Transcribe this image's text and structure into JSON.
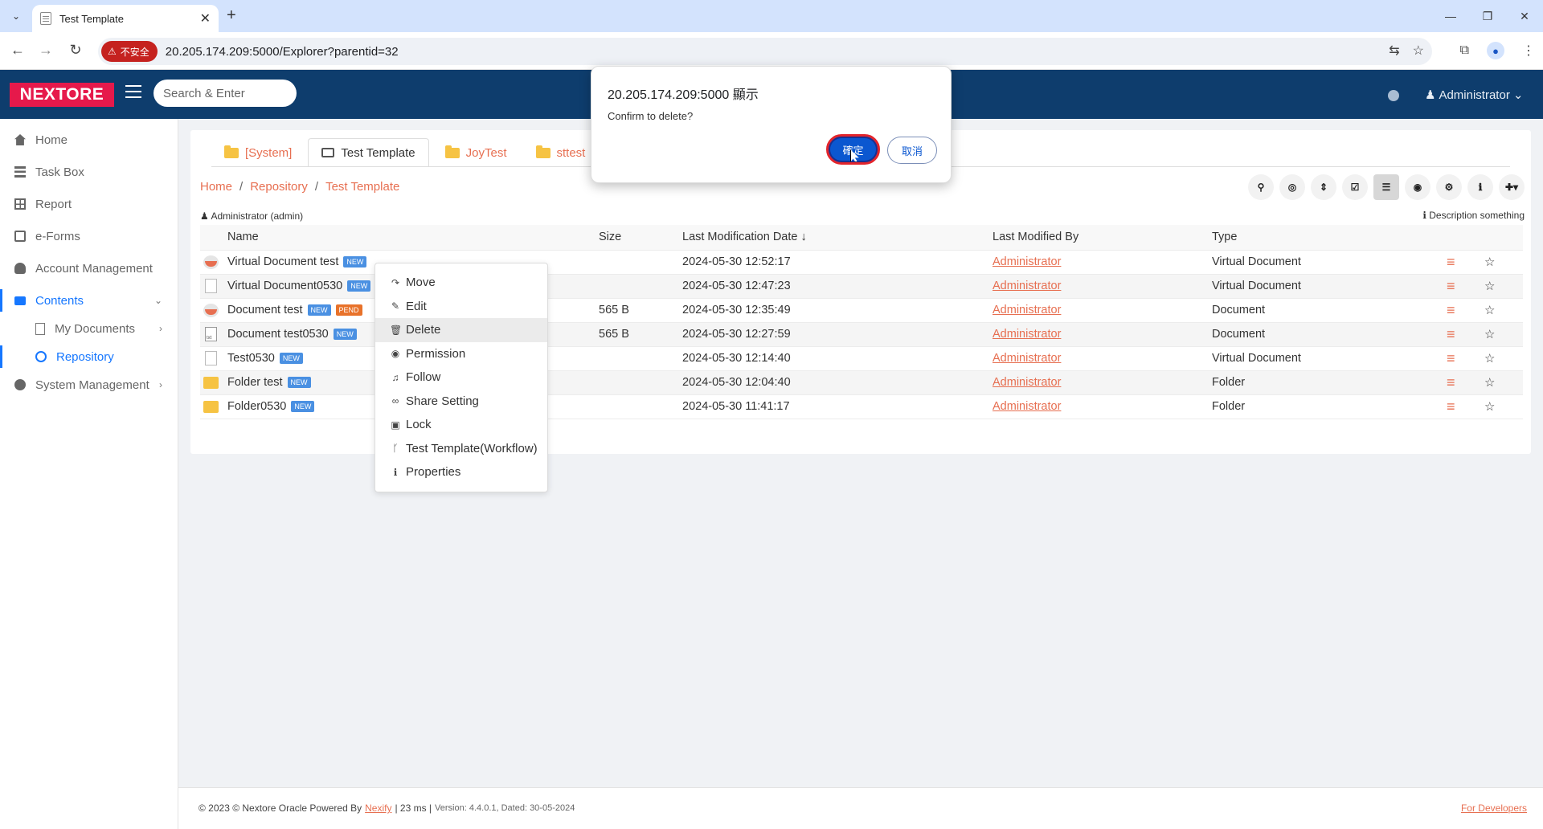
{
  "browser": {
    "tab_title": "Test Template",
    "insecure_label": "不安全",
    "url": "20.205.174.209:5000/Explorer?parentid=32"
  },
  "header": {
    "logo": "NEXTORE",
    "search_placeholder": "Search & Enter",
    "user": "Administrator"
  },
  "sidebar": {
    "items": [
      {
        "label": "Home",
        "icon": "home-icon"
      },
      {
        "label": "Task Box",
        "icon": "tasks-icon"
      },
      {
        "label": "Report",
        "icon": "table-icon"
      },
      {
        "label": "e-Forms",
        "icon": "form-icon"
      },
      {
        "label": "Account Management",
        "icon": "user-icon"
      },
      {
        "label": "Contents",
        "icon": "folder-icon"
      },
      {
        "label": "My Documents",
        "icon": "file-icon"
      },
      {
        "label": "Repository",
        "icon": "repository-icon"
      },
      {
        "label": "System Management",
        "icon": "cogs-icon"
      }
    ]
  },
  "tabs": [
    {
      "label": "[System]"
    },
    {
      "label": "Test Template"
    },
    {
      "label": "JoyTest"
    },
    {
      "label": "sttest"
    }
  ],
  "breadcrumb": [
    "Home",
    "Repository",
    "Test Template"
  ],
  "owner": "Administrator (admin)",
  "description": "Description something",
  "table": {
    "columns": [
      "Name",
      "Size",
      "Last Modification Date",
      "Last Modified By",
      "Type"
    ],
    "rows": [
      {
        "name": "Virtual Document test",
        "badge": "NEW",
        "badge2": "",
        "size": "",
        "date": "2024-05-30 12:52:17",
        "by": "Administrator",
        "type": "Virtual Document",
        "icon": "virtual-doc-icon"
      },
      {
        "name": "Virtual Document0530",
        "badge": "NEW",
        "badge2": "",
        "size": "",
        "date": "2024-05-30 12:47:23",
        "by": "Administrator",
        "type": "Virtual Document",
        "icon": "page-icon"
      },
      {
        "name": "Document test",
        "badge": "NEW",
        "badge2": "PEND",
        "size": "565 B",
        "date": "2024-05-30 12:35:49",
        "by": "Administrator",
        "type": "Document",
        "icon": "virtual-doc-icon"
      },
      {
        "name": "Document test0530",
        "badge": "NEW",
        "badge2": "",
        "size": "565 B",
        "date": "2024-05-30 12:27:59",
        "by": "Administrator",
        "type": "Document",
        "icon": "txt-file-icon"
      },
      {
        "name": "Test0530",
        "badge": "NEW",
        "badge2": "",
        "size": "",
        "date": "2024-05-30 12:14:40",
        "by": "Administrator",
        "type": "Virtual Document",
        "icon": "page-icon"
      },
      {
        "name": "Folder test",
        "badge": "NEW",
        "badge2": "",
        "size": "",
        "date": "2024-05-30 12:04:40",
        "by": "Administrator",
        "type": "Folder",
        "icon": "folder-icon"
      },
      {
        "name": "Folder0530",
        "badge": "NEW",
        "badge2": "",
        "size": "",
        "date": "2024-05-30 11:41:17",
        "by": "Administrator",
        "type": "Folder",
        "icon": "folder-icon"
      }
    ]
  },
  "context_menu": [
    {
      "label": "Move",
      "icon": "share-arrow-icon"
    },
    {
      "label": "Edit",
      "icon": "pencil-icon"
    },
    {
      "label": "Delete",
      "icon": "trash-icon"
    },
    {
      "label": "Permission",
      "icon": "user-circle-icon"
    },
    {
      "label": "Follow",
      "icon": "bell-icon"
    },
    {
      "label": "Share Setting",
      "icon": "link-icon"
    },
    {
      "label": "Lock",
      "icon": "lock-icon"
    },
    {
      "label": "Test Template(Workflow)",
      "icon": "workflow-icon"
    },
    {
      "label": "Properties",
      "icon": "info-icon"
    }
  ],
  "dialog": {
    "title": "20.205.174.209:5000 顯示",
    "message": "Confirm to delete?",
    "ok_label": "確定",
    "cancel_label": "取消"
  },
  "footer": {
    "copyright": "© 2023 © Nextore Oracle Powered By",
    "powered_link": "Nexify",
    "timing": "| 23 ms |",
    "version": "Version: 4.4.0.1, Dated: 30-05-2024",
    "dev_link": "For Developers"
  }
}
